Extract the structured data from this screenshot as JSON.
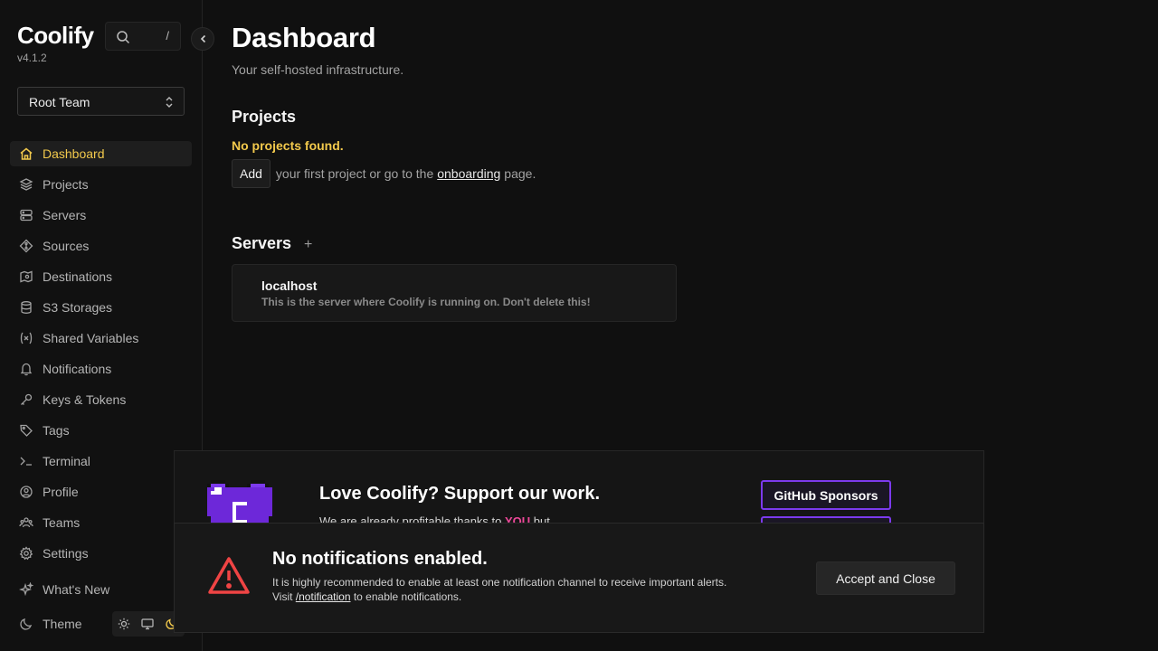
{
  "app": {
    "name": "Coolify",
    "version": "v4.1.2"
  },
  "search": {
    "shortcut": "/"
  },
  "team": {
    "selected": "Root Team"
  },
  "sidebar": {
    "items": [
      {
        "label": "Dashboard",
        "icon": "home-icon"
      },
      {
        "label": "Projects",
        "icon": "layers-icon"
      },
      {
        "label": "Servers",
        "icon": "server-icon"
      },
      {
        "label": "Sources",
        "icon": "git-icon"
      },
      {
        "label": "Destinations",
        "icon": "destination-icon"
      },
      {
        "label": "S3 Storages",
        "icon": "database-icon"
      },
      {
        "label": "Shared Variables",
        "icon": "variable-icon"
      },
      {
        "label": "Notifications",
        "icon": "bell-icon"
      },
      {
        "label": "Keys & Tokens",
        "icon": "key-icon"
      },
      {
        "label": "Tags",
        "icon": "tag-icon"
      },
      {
        "label": "Terminal",
        "icon": "terminal-icon"
      },
      {
        "label": "Profile",
        "icon": "profile-icon"
      },
      {
        "label": "Teams",
        "icon": "teams-icon"
      },
      {
        "label": "Settings",
        "icon": "gear-icon"
      }
    ],
    "whats_new": "What's New",
    "theme": "Theme"
  },
  "main": {
    "title": "Dashboard",
    "subtitle": "Your self-hosted infrastructure.",
    "projects": {
      "title": "Projects",
      "empty": "No projects found.",
      "add_label": "Add",
      "text_before": "your first project or go to the",
      "link": "onboarding",
      "text_after": "page."
    },
    "servers": {
      "title": "Servers",
      "add": "+",
      "list": [
        {
          "name": "localhost",
          "description": "This is the server where Coolify is running on. Don't delete this!"
        }
      ]
    }
  },
  "sponsor": {
    "title": "Love Coolify? Support our work.",
    "text_before": "We are already profitable thanks to",
    "highlight": "YOU",
    "text_after": "but...",
    "button": "GitHub Sponsors"
  },
  "toast": {
    "title": "No notifications enabled.",
    "line1": "It is highly recommended to enable at least one notification channel to receive important alerts.",
    "line2_before": "Visit",
    "line2_link": "/notification",
    "line2_after": "to enable notifications.",
    "button": "Accept and Close"
  },
  "colors": {
    "accent": "#f2c94c",
    "sponsor": "#7c3aed",
    "warning": "#ef4444",
    "highlight": "#ec4899"
  }
}
